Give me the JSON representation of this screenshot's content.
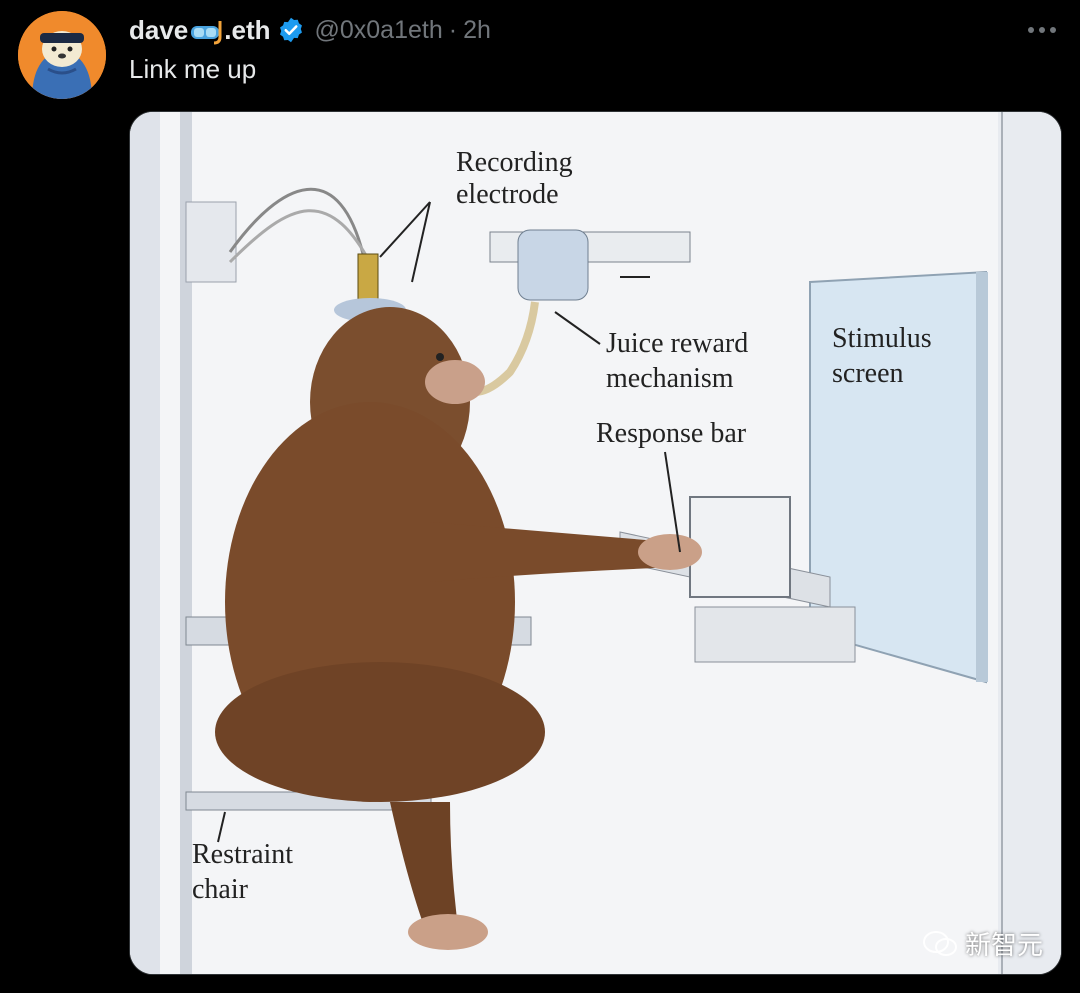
{
  "tweet": {
    "display_name_prefix": "dave",
    "display_name_suffix": ".eth",
    "name_emoji": "diving-mask-emoji",
    "handle": "@0x0a1eth",
    "separator": "·",
    "time": "2h",
    "text": "Link me up"
  },
  "figure": {
    "labels": {
      "recording_electrode_line1": "Recording",
      "recording_electrode_line2": "electrode",
      "juice_line1": "Juice reward",
      "juice_line2": "mechanism",
      "stimulus_line1": "Stimulus",
      "stimulus_line2": "screen",
      "response_bar": "Response bar",
      "restraint_line1": "Restraint",
      "restraint_line2": "chair"
    },
    "watermark": "新智元"
  },
  "colors": {
    "background": "#000000",
    "text_primary": "#e7e9ea",
    "text_secondary": "#71767b",
    "verified_badge": "#1d9bf0",
    "avatar_bg": "#f08a2c"
  }
}
